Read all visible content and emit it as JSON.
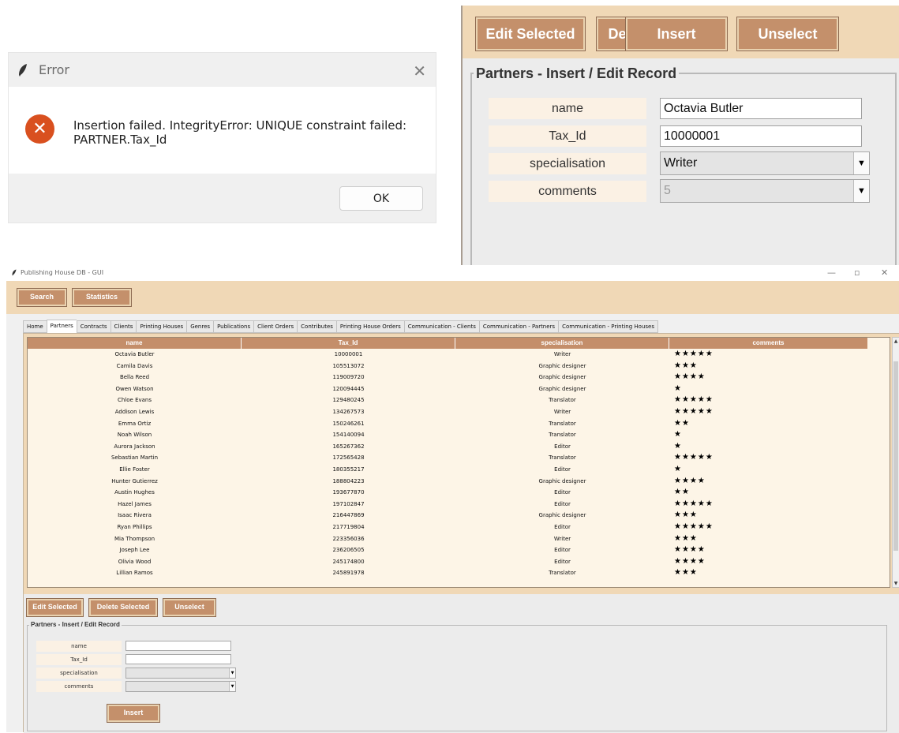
{
  "error_dialog": {
    "title": "Error",
    "close_symbol": "✕",
    "icon": "error-x-icon",
    "icon_symbol": "✕",
    "message_line1": "Insertion failed. IntegrityError: UNIQUE constraint failed:",
    "message_line2": "PARTNER.Tax_Id",
    "ok_label": "OK"
  },
  "zoom_panel": {
    "buttons": {
      "edit": "Edit Selected",
      "delete": "Delete Selected",
      "unselect": "Unselect"
    },
    "form_title": "Partners - Insert / Edit Record",
    "fields": [
      {
        "label": "name",
        "value": "Octavia Butler"
      },
      {
        "label": "Tax_Id",
        "value": "10000001"
      },
      {
        "label": "specialisation",
        "value": "Writer"
      },
      {
        "label": "comments",
        "value": "5"
      }
    ],
    "dropdown_arrow": "▼",
    "insert_label": "Insert"
  },
  "main_window": {
    "title": "Publishing House DB - GUI",
    "window_controls": {
      "minimize": "—",
      "restore": "▫",
      "close": "✕"
    },
    "top_buttons": {
      "search": "Search",
      "statistics": "Statistics"
    },
    "tabs": [
      "Home",
      "Partners",
      "Contracts",
      "Clients",
      "Printing Houses",
      "Genres",
      "Publications",
      "Client Orders",
      "Contributes",
      "Printing House Orders",
      "Communication - Clients",
      "Communication - Partners",
      "Communication - Printing Houses"
    ],
    "active_tab": "Partners",
    "table": {
      "columns": [
        "name",
        "Tax_Id",
        "specialisation",
        "comments"
      ],
      "rows": [
        [
          "Octavia Butler",
          "10000001",
          "Writer",
          5
        ],
        [
          "Camila Davis",
          "105513072",
          "Graphic designer",
          3
        ],
        [
          "Bella Reed",
          "119009720",
          "Graphic designer",
          4
        ],
        [
          "Owen Watson",
          "120094445",
          "Graphic designer",
          1
        ],
        [
          "Chloe Evans",
          "129480245",
          "Translator",
          5
        ],
        [
          "Addison Lewis",
          "134267573",
          "Writer",
          5
        ],
        [
          "Emma Ortiz",
          "150246261",
          "Translator",
          2
        ],
        [
          "Noah Wilson",
          "154140094",
          "Translator",
          1
        ],
        [
          "Aurora Jackson",
          "165267362",
          "Editor",
          1
        ],
        [
          "Sebastian Martin",
          "172565428",
          "Translator",
          5
        ],
        [
          "Ellie Foster",
          "180355217",
          "Editor",
          1
        ],
        [
          "Hunter Gutierrez",
          "188804223",
          "Graphic designer",
          4
        ],
        [
          "Austin Hughes",
          "193677870",
          "Editor",
          2
        ],
        [
          "Hazel James",
          "197102847",
          "Editor",
          5
        ],
        [
          "Isaac Rivera",
          "216447869",
          "Graphic designer",
          3
        ],
        [
          "Ryan Phillips",
          "217719804",
          "Editor",
          5
        ],
        [
          "Mia Thompson",
          "223356036",
          "Writer",
          3
        ],
        [
          "Joseph Lee",
          "236206505",
          "Editor",
          4
        ],
        [
          "Olivia Wood",
          "245174800",
          "Editor",
          4
        ],
        [
          "Lillian Ramos",
          "245891978",
          "Translator",
          3
        ]
      ],
      "star_glyph": "★",
      "scroll_up": "▲",
      "scroll_down": "▼"
    },
    "action_buttons": {
      "edit": "Edit Selected",
      "delete": "Delete Selected",
      "unselect": "Unselect"
    },
    "form": {
      "title": "Partners - Insert / Edit Record",
      "labels": [
        "name",
        "Tax_Id",
        "specialisation",
        "comments"
      ],
      "dropdown_arrow": "▼",
      "insert_label": "Insert"
    }
  },
  "colors": {
    "beige": "#f0d8b6",
    "button_brown": "#c4906b",
    "error_red": "#d9501f",
    "table_bg": "#fdf5e7"
  }
}
